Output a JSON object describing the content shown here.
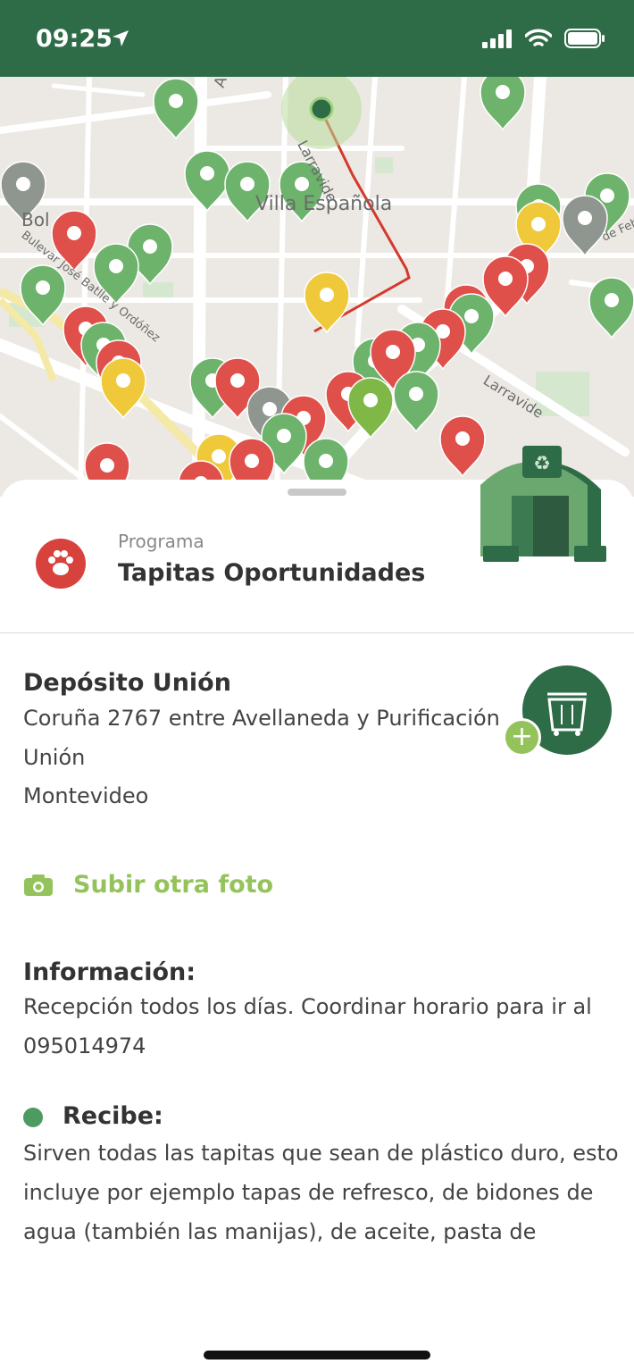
{
  "status": {
    "time": "09:25",
    "icons": [
      "location-arrow-icon",
      "cellular-signal-icon",
      "wifi-icon",
      "battery-icon"
    ]
  },
  "map": {
    "labels": {
      "street_avenue": "Ave",
      "street_larravide_1": "Larravide",
      "street_larravide_2": "Larravide",
      "neighborhood": "Villa Española",
      "area_bol": "Bol",
      "street_boulevard": "Bulevar José Batlle y Ordóñez",
      "street_feb": "de Feb"
    },
    "marker_colors": {
      "green": "#6db36c",
      "red": "#e0504a",
      "yellow": "#f0c93a",
      "gray": "#8f9690",
      "lime": "#7fb847"
    },
    "route_color": "#d33a2c"
  },
  "sheet": {
    "program": {
      "caption": "Programa",
      "name": "Tapitas Oportunidades",
      "icon": "paw-icon"
    },
    "depot": {
      "title": "Depósito Unión",
      "address_line1": "Coruña 2767 entre Avellaneda y Purificación",
      "address_line2": "Unión",
      "address_line3": "Montevideo",
      "container_icon": "dumpster-icon",
      "add_icon": "plus-icon"
    },
    "upload": {
      "label": "Subir otra foto",
      "icon": "camera-icon"
    },
    "info": {
      "title": "Información:",
      "text": "Recepción todos los días. Coordinar horario para ir al 095014974"
    },
    "receives": {
      "title": "Recibe:",
      "text": "Sirven todas las tapitas que sean de plástico duro, esto incluye por ejemplo tapas de refresco, de bidones de agua (también las manijas), de aceite, pasta de"
    }
  },
  "colors": {
    "brand_green": "#2e6b47",
    "accent_lime": "#95c35b",
    "program_red": "#d8423c"
  }
}
